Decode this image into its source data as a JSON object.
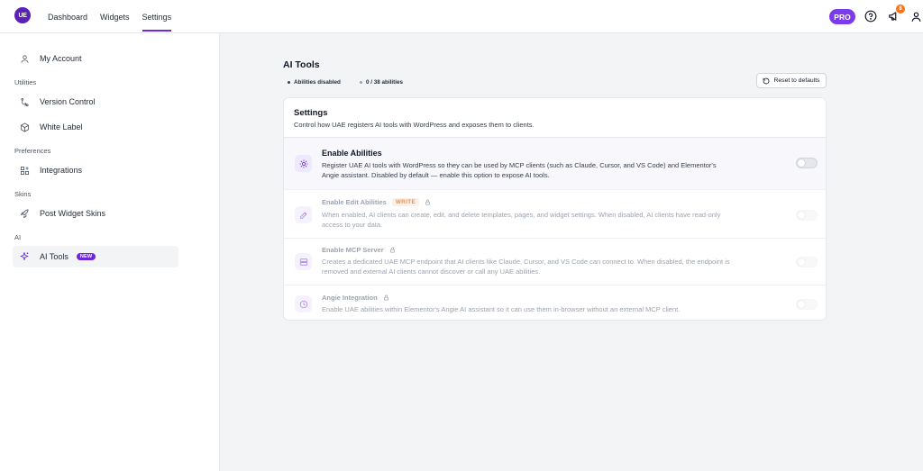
{
  "brand": {
    "logo_text": "UE",
    "accent": "#6d28d9"
  },
  "nav": {
    "items": [
      {
        "label": "Dashboard"
      },
      {
        "label": "Widgets"
      },
      {
        "label": "Settings",
        "active": true
      }
    ]
  },
  "topbar": {
    "pro_label": "PRO",
    "notification_count": "8",
    "icons": [
      "help-circle-icon",
      "megaphone-icon",
      "user-icon"
    ]
  },
  "sidebar": {
    "items": [
      {
        "label": "My Account",
        "icon": "user-icon"
      },
      {
        "label": "Version Control",
        "icon": "version-icon"
      },
      {
        "label": "White Label",
        "icon": "box-icon"
      },
      {
        "label": "Integrations",
        "icon": "grid-plus-icon"
      },
      {
        "label": "Post Widget Skins",
        "icon": "rocket-icon"
      },
      {
        "label": "AI Tools",
        "icon": "sparkle-icon",
        "active": true,
        "badge": "NEW"
      }
    ],
    "sections": {
      "utilities": "Utilities",
      "preferences": "Preferences",
      "skins": "Skins",
      "ai": "AI"
    }
  },
  "main": {
    "title": "AI Tools",
    "chips": [
      {
        "label": "Abilities disabled",
        "color": "#374151"
      },
      {
        "label": "0 / 38 abilities",
        "color": "#9ca3af"
      }
    ],
    "reset_label": "Reset to defaults",
    "card": {
      "title": "Settings",
      "subtitle": "Control how UAE registers AI tools with WordPress and exposes them to clients.",
      "rows": [
        {
          "title": "Enable Abilities",
          "description": "Register UAE AI tools with WordPress so they can be used by MCP clients (such as Claude, Cursor, and VS Code) and Elementor's Angie assistant. Disabled by default — enable this option to expose AI tools.",
          "icon": "sun-icon",
          "enabled": false
        },
        {
          "title": "Enable Edit Abilities",
          "badge": "WRITE",
          "description": "When enabled, AI clients can create, edit, and delete templates, pages, and widget settings. When disabled, AI clients have read-only access to your data.",
          "icon": "edit-icon",
          "locked": true
        },
        {
          "title": "Enable MCP Server",
          "description": "Creates a dedicated UAE MCP endpoint that AI clients like Claude, Cursor, and VS Code can connect to. When disabled, the endpoint is removed and external AI clients cannot discover or call any UAE abilities.",
          "icon": "server-icon",
          "locked": true
        },
        {
          "title": "Angie Integration",
          "description": "Enable UAE abilities within Elementor's Angie AI assistant so it can use them in-browser without an external MCP client.",
          "icon": "clock-icon",
          "locked": true
        }
      ]
    }
  }
}
